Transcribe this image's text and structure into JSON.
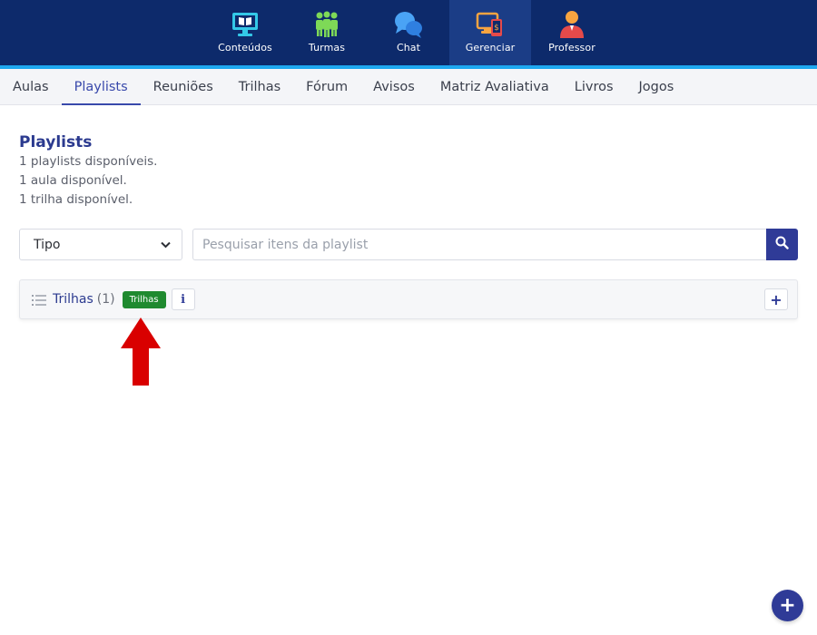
{
  "topnav": {
    "items": [
      {
        "label": "Conteúdos",
        "icon": "monitor-book-icon",
        "active": false
      },
      {
        "label": "Turmas",
        "icon": "group-people-icon",
        "active": false
      },
      {
        "label": "Chat",
        "icon": "chat-bubbles-icon",
        "active": false
      },
      {
        "label": "Gerenciar",
        "icon": "manage-devices-icon",
        "active": true
      },
      {
        "label": "Professor",
        "icon": "teacher-icon",
        "active": false
      }
    ],
    "colors": {
      "bar": "#0d2a6b",
      "accent": "#1ea8f0"
    }
  },
  "subtabs": {
    "items": [
      "Aulas",
      "Playlists",
      "Reuniões",
      "Trilhas",
      "Fórum",
      "Avisos",
      "Matriz Avaliativa",
      "Livros",
      "Jogos"
    ],
    "active": "Playlists"
  },
  "page": {
    "title": "Playlists",
    "stats": [
      "1 playlists disponíveis.",
      "1 aula disponível.",
      "1 trilha disponível."
    ]
  },
  "filters": {
    "type_select": "Tipo",
    "search_placeholder": "Pesquisar itens da playlist",
    "search_icon": "search-icon"
  },
  "playlist": {
    "title": "Trilhas",
    "count": "(1)",
    "badge": "Trilhas",
    "badge_color": "#1f8a2f",
    "info_label": "i",
    "add_label": "+"
  },
  "annotation": {
    "arrow_color": "#d90000"
  },
  "fab": {
    "label": "+"
  }
}
